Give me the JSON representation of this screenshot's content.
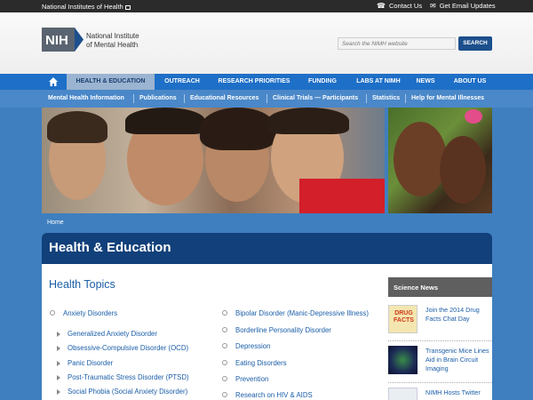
{
  "topbar": {
    "nih_link": "National Institutes of Health",
    "contact": "Contact Us",
    "email": "Get Email Updates"
  },
  "header": {
    "logo_mark": "NIH",
    "logo_line1": "National Institute",
    "logo_line2": "of Mental Health",
    "search_placeholder": "Search the NIMH website",
    "search_button": "SEARCH"
  },
  "mainnav": {
    "items": [
      "HEALTH & EDUCATION",
      "OUTREACH",
      "RESEARCH PRIORITIES",
      "FUNDING",
      "LABS AT NIMH",
      "NEWS",
      "ABOUT US"
    ]
  },
  "subnav": {
    "items": [
      "Mental Health Information",
      "Publications",
      "Educational Resources",
      "Clinical Trials — Participants",
      "Statistics",
      "Help for Mental Illnesses"
    ]
  },
  "breadcrumb": "Home",
  "page_title": "Health & Education",
  "topics": {
    "title": "Health Topics",
    "left": [
      {
        "label": "Anxiety Disorders",
        "level": 0
      },
      {
        "label": "Generalized Anxiety Disorder",
        "level": 1
      },
      {
        "label": "Obsessive-Compulsive Disorder (OCD)",
        "level": 1
      },
      {
        "label": "Panic Disorder",
        "level": 1
      },
      {
        "label": "Post-Traumatic Stress Disorder (PTSD)",
        "level": 1
      },
      {
        "label": "Social Phobia (Social Anxiety Disorder)",
        "level": 1
      }
    ],
    "right": [
      "Bipolar Disorder (Manic-Depressive Illness)",
      "Borderline Personality Disorder",
      "Depression",
      "Eating Disorders",
      "Prevention",
      "Research on HIV & AIDS"
    ]
  },
  "news": {
    "title": "Science News",
    "items": [
      {
        "text": "Join the 2014 Drug Facts Chat Day",
        "thumb_text": "DRUG FACTS"
      },
      {
        "text": "Transgenic Mice Lines Aid in Brain Circuit Imaging"
      },
      {
        "text": "NIMH Hosts Twitter"
      }
    ]
  },
  "colors": {
    "nav_blue": "#1e6fc7",
    "subnav_blue": "#4a88c9",
    "title_bar": "#11407a",
    "link": "#1b5ea8"
  }
}
